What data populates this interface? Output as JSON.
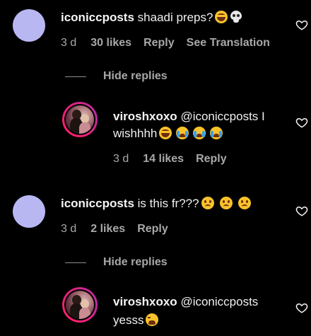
{
  "comments": [
    {
      "username": "iconiccposts",
      "text": "shaadi preps?",
      "emojis": [
        "laughing-tears",
        "skull"
      ],
      "time": "3 d",
      "likes": "30 likes",
      "reply": "Reply",
      "translation": "See Translation"
    },
    {
      "username": "iconiccposts",
      "text": "is this fr???",
      "emojis": [
        "sad-face",
        "sad-face",
        "sad-face"
      ],
      "time": "3 d",
      "likes": "2 likes",
      "reply": "Reply"
    }
  ],
  "hide_replies_label": "Hide replies",
  "replies": [
    {
      "username": "viroshxoxo",
      "text_line1": "@iconiccposts I",
      "text_line2": "wishhhh",
      "emojis": [
        "laughing-tears",
        "crying",
        "crying",
        "crying"
      ],
      "time": "3 d",
      "likes": "14 likes",
      "reply": "Reply"
    },
    {
      "username": "viroshxoxo",
      "text_line1": "@iconiccposts",
      "text_line2": "yesss",
      "emojis": [
        "tired-face"
      ]
    }
  ],
  "colors": {
    "background": "#000000",
    "avatar_plain": "#b9b7f2",
    "meta_text": "#a8a8a8",
    "story_ring": "#e3227b"
  }
}
